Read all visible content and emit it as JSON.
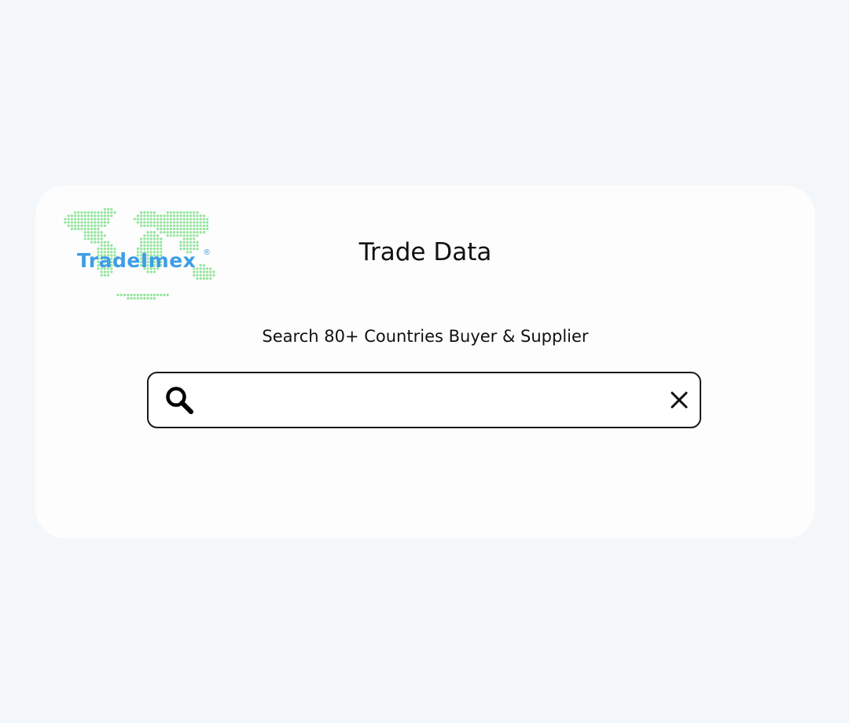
{
  "brand": {
    "logo_text": "TradeImex",
    "registered_mark": "®",
    "text_color": "#3d9de8",
    "map_color": "#7fe08a"
  },
  "header": {
    "title": "Trade Data"
  },
  "hero": {
    "subtitle": "Search 80+ Countries Buyer & Supplier"
  },
  "search": {
    "value": "",
    "placeholder": "",
    "search_icon": "search-icon",
    "clear_icon": "close-icon"
  },
  "colors": {
    "background": "#f4f7f9",
    "card": "#fdfdfd",
    "border": "#1a1a1a"
  }
}
